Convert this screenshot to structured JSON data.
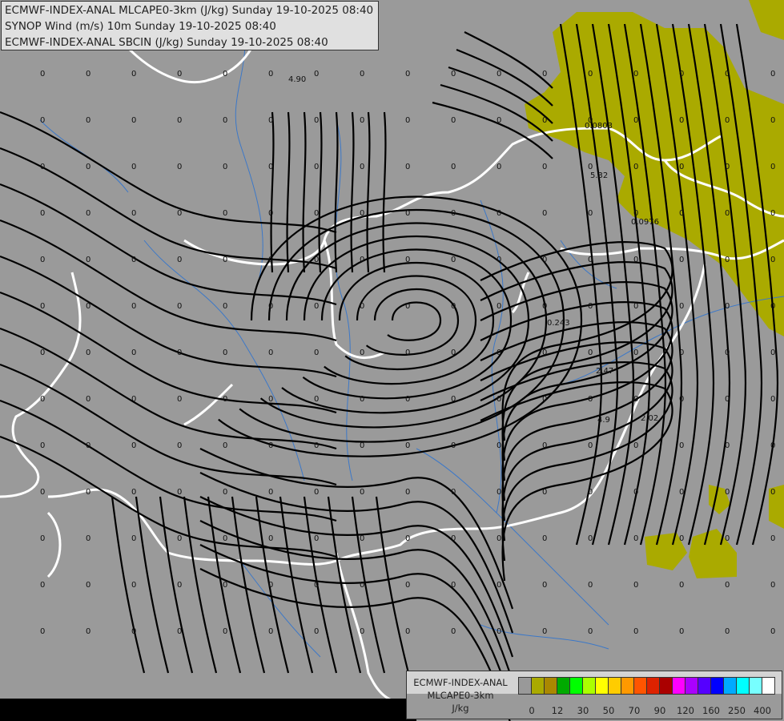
{
  "header": {
    "lines": [
      "ECMWF-INDEX-ANAL MLCAPE0-3km (J/kg) Sunday 19-10-2025 08:40",
      "SYNOP Wind (m/s) 10m Sunday 19-10-2025 08:40",
      "ECMWF-INDEX-ANAL SBCIN (J/kg) Sunday 19-10-2025 08:40"
    ]
  },
  "legend": {
    "model": "ECMWF-INDEX-ANAL",
    "parameter": "MLCAPE0-3km",
    "unit": "J/kg",
    "colors": [
      "#999999",
      "#aaaa00",
      "#aa8800",
      "#00aa00",
      "#00ff00",
      "#aaff00",
      "#ffff00",
      "#ffcc00",
      "#ff9900",
      "#ff5500",
      "#dd2200",
      "#aa0000",
      "#ff00ff",
      "#aa00ff",
      "#5500ff",
      "#0000ff",
      "#00aaff",
      "#00ffff",
      "#77ffff",
      "#ffffff"
    ],
    "ticks": [
      "0",
      "12",
      "30",
      "50",
      "70",
      "90",
      "120",
      "160",
      "250",
      "400"
    ]
  },
  "map": {
    "cape_fill_color": "#aaaa00",
    "border_color": "#ffffff",
    "river_color": "#3c78c8",
    "streamline_color": "#000000",
    "value_labels": [
      "4.90",
      "0.0803",
      "5.32",
      "0.0976",
      "0.243",
      "2.47",
      "4.9",
      "2.02"
    ],
    "zero_label": "0"
  }
}
